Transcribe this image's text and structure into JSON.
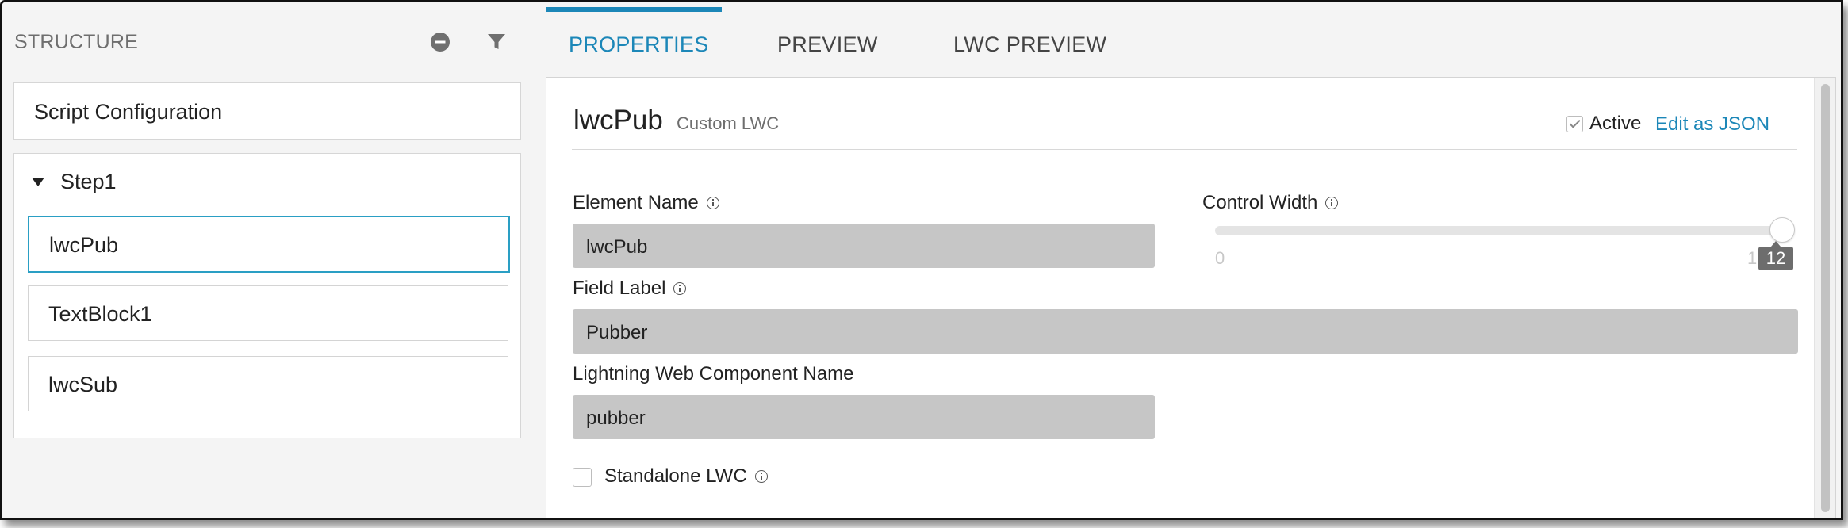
{
  "structure": {
    "title": "STRUCTURE",
    "items": {
      "script_config": "Script Configuration",
      "step": "Step1",
      "children": [
        "lwcPub",
        "TextBlock1",
        "lwcSub"
      ]
    }
  },
  "tabs": [
    "PROPERTIES",
    "PREVIEW",
    "LWC PREVIEW"
  ],
  "active_tab": "PROPERTIES",
  "properties": {
    "element_title": "lwcPub",
    "element_type": "Custom LWC",
    "active_label": "Active",
    "active_checked": true,
    "edit_json_label": "Edit as JSON",
    "element_name_label": "Element Name",
    "element_name_value": "lwcPub",
    "control_width_label": "Control Width",
    "control_width_min": "0",
    "control_width_max_partial": "1",
    "control_width_value": "12",
    "field_label_label": "Field Label",
    "field_label_value": "Pubber",
    "lwc_name_label": "Lightning Web Component Name",
    "lwc_name_value": "pubber",
    "standalone_label": "Standalone LWC",
    "standalone_checked": false
  },
  "colors": {
    "accent": "#1c87b8",
    "selected_border": "#2a9fc4",
    "field_bg": "#c6c6c6"
  },
  "icons": [
    "minus-circle-icon",
    "filter-icon",
    "caret-down-icon",
    "info-icon",
    "checkbox-icon"
  ]
}
